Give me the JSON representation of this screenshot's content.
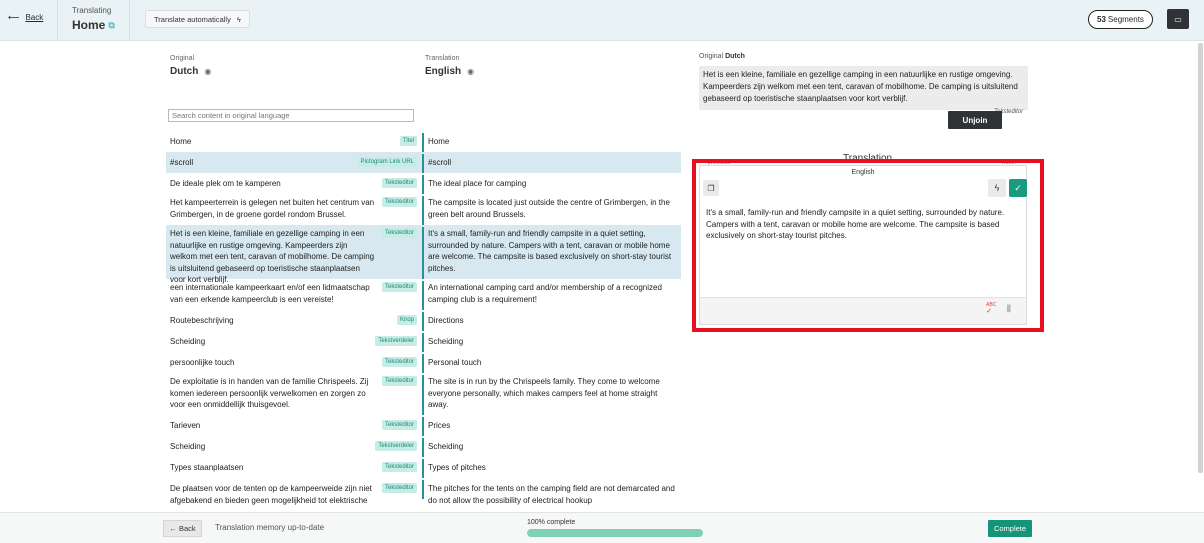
{
  "header": {
    "back_label": "Back",
    "translating_label": "Translating",
    "page_title": "Home",
    "translate_auto_label": "Translate automatically",
    "segments_count": "53",
    "segments_label": "Segments"
  },
  "columns": {
    "original_small": "Original",
    "original_lang": "Dutch",
    "translation_small": "Translation",
    "translation_lang": "English"
  },
  "search": {
    "placeholder": "Search content in original language"
  },
  "segments": [
    {
      "original": "Home",
      "tag": "Titel",
      "translation": "Home",
      "highlight": false
    },
    {
      "original": "#scroll",
      "tag": "Pictogram Link URL",
      "translation": "#scroll",
      "highlight": true
    },
    {
      "original": "De ideale plek om te kamperen",
      "tag": "Teksteditor",
      "translation": "The ideal place for camping",
      "highlight": false
    },
    {
      "original": "Het kampeerterrein is gelegen net buiten het centrum van Grimbergen, in de groene gordel rondom Brussel.",
      "tag": "Teksteditor",
      "translation": "The campsite is located just outside the centre of Grimbergen, in the green belt around Brussels.",
      "highlight": false
    },
    {
      "original": "Het is een kleine, familiale en gezellige camping in een natuurlijke en rustige omgeving. Kampeerders zijn welkom met een tent, caravan of mobilhome. De camping is uitsluitend gebaseerd op toeristische staanplaatsen voor kort verblijf.",
      "tag": "Teksteditor",
      "translation": "It's a small, family-run and friendly campsite in a quiet setting, surrounded by nature. Campers with a tent, caravan or mobile home are welcome. The campsite is based exclusively on short-stay tourist pitches.",
      "highlight": true
    },
    {
      "original": "een internationale kampeerkaart en/of een lidmaatschap van een erkende kampeerclub is een vereiste!",
      "tag": "Teksteditor",
      "translation": "An international camping card and/or membership of a recognized camping club is a requirement!",
      "highlight": false
    },
    {
      "original": "Routebeschrijving",
      "tag": "Knop",
      "translation": "Directions",
      "highlight": false
    },
    {
      "original": "Scheiding",
      "tag": "Tekstverdeler",
      "translation": "Scheiding",
      "highlight": false
    },
    {
      "original": "persoonlijke touch",
      "tag": "Teksteditor",
      "translation": "Personal touch",
      "highlight": false
    },
    {
      "original": "De exploitatie is in handen van de familie Chrispeels. Zij komen iedereen persoonlijk verwelkomen en zorgen zo voor een onmiddellijk thuisgevoel.",
      "tag": "Teksteditor",
      "translation": "The site is in run by the Chrispeels family. They come to welcome everyone personally, which makes campers feel at home straight away.",
      "highlight": false
    },
    {
      "original": "Tarieven",
      "tag": "Teksteditor",
      "translation": "Prices",
      "highlight": false
    },
    {
      "original": "Scheiding",
      "tag": "Tekstverdeler",
      "translation": "Scheiding",
      "highlight": false
    },
    {
      "original": "Types staanplaatsen",
      "tag": "Teksteditor",
      "translation": "Types of pitches",
      "highlight": false
    },
    {
      "original": "De plaatsen voor de tenten op de kampeerweide zijn niet afgebakend en bieden geen mogelijkheid tot elektrische",
      "tag": "Teksteditor",
      "translation": "The pitches for the tents on the camping field are not demarcated and do not allow the possibility of electrical hookup",
      "highlight": false
    }
  ],
  "panel": {
    "original_label": "Original",
    "original_lang": "Dutch",
    "original_text": "Het is een kleine, familiale en gezellige camping in een natuurlijke en rustige omgeving. Kampeerders zijn welkom met een tent, caravan of mobilhome. De camping is uitsluitend gebaseerd op toeristische staanplaatsen voor kort verblijf.",
    "original_tag": "Teksteditor",
    "unjoin_label": "Unjoin",
    "translation_heading": "Translation",
    "previous_label": "previous",
    "next_label": "next",
    "editor_lang": "English",
    "editor_text": "It's a small, family-run and friendly campsite in a quiet setting, surrounded by nature. Campers with a tent, caravan or mobile home are welcome. The campsite is based exclusively on short-stay tourist pitches.",
    "spell_label": "ABC"
  },
  "footer": {
    "back_label": "← Back",
    "memory_status": "Translation memory up-to-date",
    "progress_label": "100% complete",
    "progress_value": 1.0,
    "complete_label": "Complete"
  },
  "colors": {
    "accent": "#16947a",
    "highlight_row": "#d7e8f1",
    "segment_bar": "#2a8e9e",
    "red_box": "#e8101f"
  }
}
